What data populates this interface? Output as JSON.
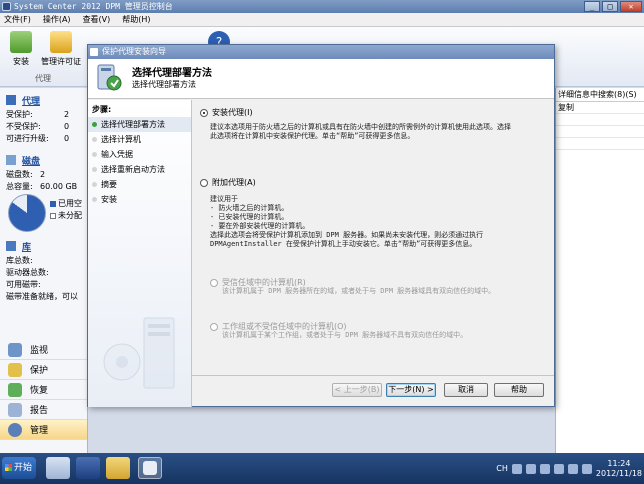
{
  "window": {
    "title": "System Center 2012 DPM 管理员控制台"
  },
  "menu": {
    "items": [
      "文件(F)",
      "操作(A)",
      "查看(V)",
      "帮助(H)"
    ]
  },
  "ribbon": {
    "install": "安装",
    "manage_license": "管理许可证",
    "group": "代理"
  },
  "left": {
    "agents": {
      "title": "代理",
      "rows": [
        {
          "k": "受保护:",
          "v": "2"
        },
        {
          "k": "不受保护:",
          "v": "0"
        },
        {
          "k": "可进行升级:",
          "v": "0"
        }
      ]
    },
    "disks": {
      "title": "磁盘",
      "rows": [
        {
          "k": "磁盘数:",
          "v": "2"
        },
        {
          "k": "总容量:",
          "v": "60.00 GB"
        }
      ],
      "used": "已用空",
      "unalloc": "未分配"
    },
    "library": {
      "title": "库",
      "rows": [
        "库总数:",
        "驱动器总数:",
        "可用磁带:",
        "磁带准备就绪，可以"
      ]
    },
    "nav": [
      "监视",
      "保护",
      "恢复",
      "报告",
      "管理"
    ]
  },
  "right": {
    "header": "详细信息中搜索(8)(S)",
    "row1": "复制"
  },
  "dialog": {
    "title": "保护代理安装向导",
    "header_title": "选择代理部署方法",
    "header_sub": "选择代理部署方法",
    "steps_label": "步骤:",
    "steps": [
      "选择代理部署方法",
      "选择计算机",
      "输入凭据",
      "选择重新启动方法",
      "摘要",
      "安装"
    ],
    "opt1": {
      "label": "安装代理(I)",
      "desc": "建议本选项用于防火墙之后的计算机或具有在防火墙中创建的所需例外的计算机使用此选项。选择\n此选项将在计算机中安装保护代理。单击“帮助”可获得更多信息。"
    },
    "opt2": {
      "label": "附加代理(A)",
      "desc": "建议用于\n- 防火墙之后的计算机。\n- 已安装代理的计算机。\n- 要在外部安装代理的计算机。",
      "desc2": "选择此选项会将受保护计算机添加到 DPM 服务器。如果尚未安装代理，则必须通过执行\nDPMAgentInstaller 在受保护计算机上手动安装它。单击“帮助”可获得更多信息。"
    },
    "sub1": {
      "label": "受信任域中的计算机(R)",
      "desc": "该计算机属于 DPM 服务器所在的域，或者处于与 DPM 服务器域具有双向信任的域中。"
    },
    "sub2": {
      "label": "工作组或不受信任域中的计算机(O)",
      "desc": "该计算机属于某个工作组，或者处于与 DPM 服务器域不具有双向信任的域中。"
    },
    "buttons": {
      "back": "< 上一步(B)",
      "next": "下一步(N) >",
      "cancel": "取消",
      "help": "帮助"
    }
  },
  "taskbar": {
    "start": "开始",
    "lang": "CH",
    "time": "11:24",
    "date": "2012/11/18"
  },
  "colors": {
    "accent": "#1f4fa0",
    "title_bar": "#6d8bbb",
    "taskbar": "#163461"
  }
}
